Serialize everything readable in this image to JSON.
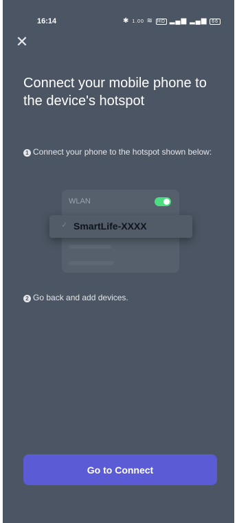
{
  "status_bar": {
    "time": "16:14",
    "icons": [
      "bluetooth-icon",
      "data-speed-icon",
      "wifi-icon",
      "hd-icon",
      "signal-icon",
      "signal-icon",
      "battery-icon"
    ],
    "data_speed": "1.00",
    "battery": "66"
  },
  "header": {
    "close_icon": "close-icon",
    "title": "Connect your mobile phone to the device's hotspot"
  },
  "steps": [
    {
      "number": "1",
      "text": "Connect your phone to the hotspot shown below:"
    },
    {
      "number": "2",
      "text": "Go back and add devices."
    }
  ],
  "wifi_illustration": {
    "wlan_label": "WLAN",
    "toggle_on": true,
    "ssid": "SmartLife-XXXX",
    "check_icon": "check-icon"
  },
  "footer": {
    "connect_label": "Go to Connect"
  },
  "colors": {
    "background": "#4b5563",
    "accent": "#5b5bd6",
    "toggle": "#4ade80"
  }
}
